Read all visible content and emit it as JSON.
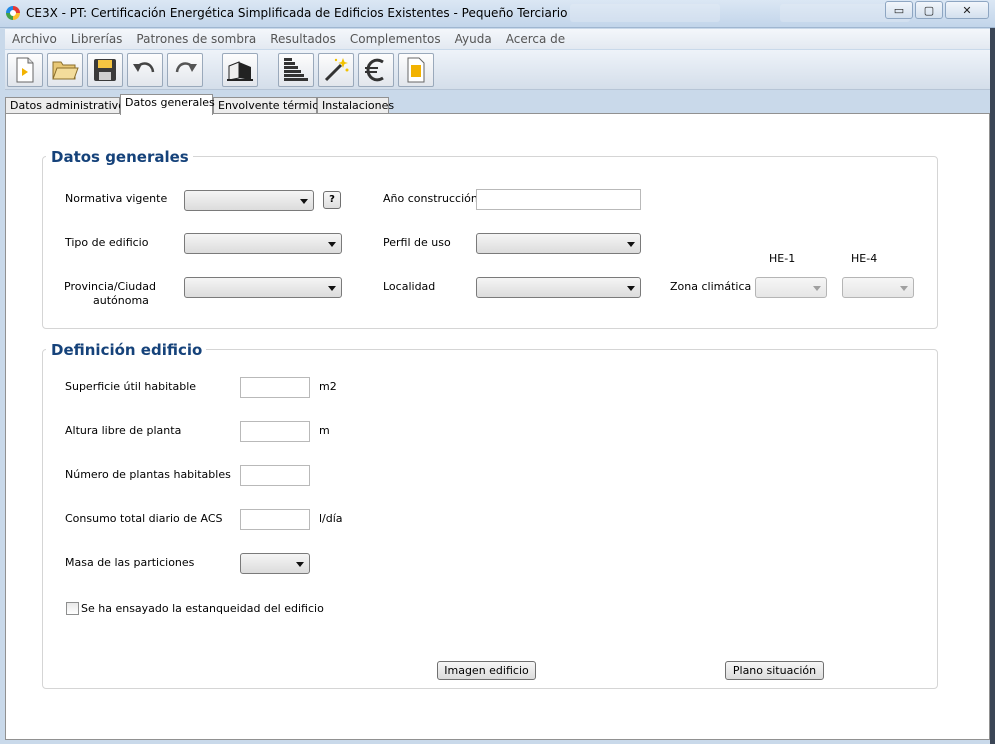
{
  "window": {
    "title": "CE3X - PT: Certificación Energética Simplificada de Edificios Existentes - Pequeño Terciario",
    "controls": {
      "minimize": "▭",
      "maximize": "▢",
      "close": "✕"
    }
  },
  "menu": [
    "Archivo",
    "Librerías",
    "Patrones de sombra",
    "Resultados",
    "Complementos",
    "Ayuda",
    "Acerca de"
  ],
  "toolbar": {
    "icons": [
      "new-file-icon",
      "open-folder-icon",
      "save-disk-icon",
      "undo-icon",
      "redo-icon",
      "building-3d-icon",
      "energy-rating-icon",
      "magic-wand-icon",
      "euro-icon",
      "report-icon"
    ]
  },
  "tabs": [
    "Datos administrativos",
    "Datos generales",
    "Envolvente térmica",
    "Instalaciones"
  ],
  "active_tab": "Datos generales",
  "datos_generales": {
    "title": "Datos generales",
    "normativa_label": "Normativa vigente",
    "help_label": "?",
    "anio_label": "Año construcción",
    "anio_value": "",
    "tipo_label": "Tipo de edificio",
    "perfil_label": "Perfil de uso",
    "provincia_label_1": "Provincia/Ciudad",
    "provincia_label_2": "autónoma",
    "localidad_label": "Localidad",
    "zona_label": "Zona climática",
    "he1_label": "HE-1",
    "he4_label": "HE-4",
    "normativa_value": "",
    "tipo_value": "",
    "perfil_value": "",
    "provincia_value": "",
    "localidad_value": "",
    "he1_value": "",
    "he4_value": ""
  },
  "definicion": {
    "title": "Definición edificio",
    "superficie_label": "Superficie útil habitable",
    "superficie_unit": "m2",
    "superficie_value": "",
    "altura_label": "Altura libre de planta",
    "altura_unit": "m",
    "altura_value": "",
    "plantas_label": "Número de plantas habitables",
    "plantas_value": "",
    "acs_label": "Consumo total diario de ACS",
    "acs_unit": "l/día",
    "acs_value": "",
    "masa_label": "Masa de las particiones",
    "masa_value": "",
    "estanqueidad_label": "Se ha ensayado la estanqueidad del edificio",
    "estanqueidad_checked": false,
    "imagen_button": "Imagen edificio",
    "plano_button": "Plano situación"
  },
  "colors": {
    "group_title": "#15427a",
    "title_bar": "#c2d5ea",
    "window_edge": "#3b4656"
  }
}
